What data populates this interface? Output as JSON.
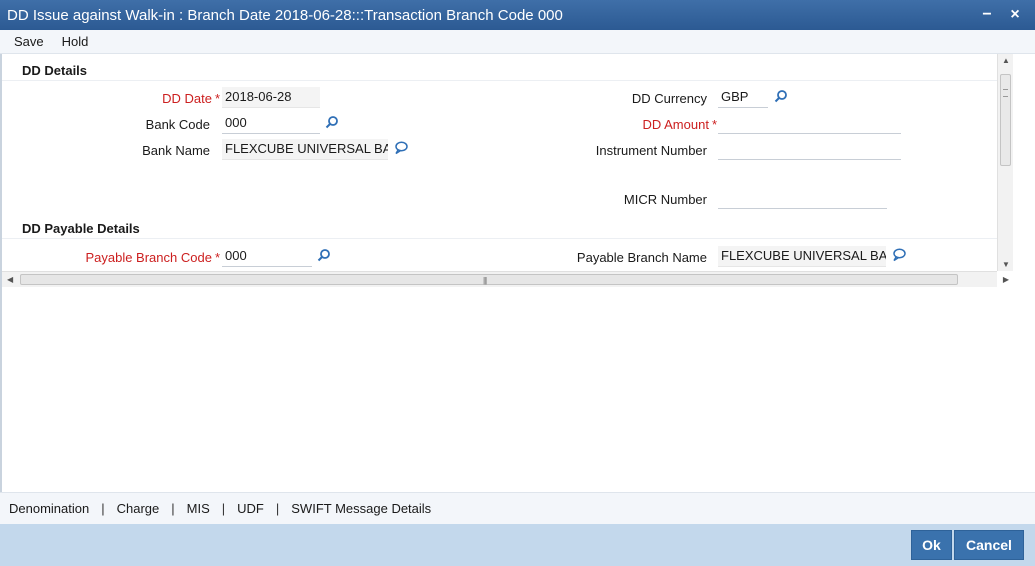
{
  "window": {
    "title": "DD Issue against Walk-in : Branch Date 2018-06-28:::Transaction Branch Code 000",
    "minimize_glyph": "−",
    "close_glyph": "×"
  },
  "menu": {
    "save": "Save",
    "hold": "Hold"
  },
  "dd_details": {
    "header": "DD Details",
    "dd_date_label": "DD Date",
    "dd_date_value": "2018-06-28",
    "bank_code_label": "Bank Code",
    "bank_code_value": "000",
    "bank_name_label": "Bank Name",
    "bank_name_value": "FLEXCUBE UNIVERSAL BA",
    "dd_currency_label": "DD Currency",
    "dd_currency_value": "GBP",
    "dd_amount_label": "DD Amount",
    "dd_amount_value": "",
    "instrument_number_label": "Instrument Number",
    "instrument_number_value": "",
    "micr_number_label": "MICR Number",
    "micr_number_value": "",
    "required_marker": "*"
  },
  "payable_details": {
    "header": "DD Payable Details",
    "payable_branch_code_label": "Payable Branch Code",
    "payable_branch_code_value": "000",
    "payable_branch_name_label": "Payable Branch Name",
    "payable_branch_name_value": "FLEXCUBE UNIVERSAL BA"
  },
  "subtabs": {
    "denomination": "Denomination",
    "charge": "Charge",
    "mis": "MIS",
    "udf": "UDF",
    "swift": "SWIFT Message Details",
    "separator": "|"
  },
  "footer": {
    "ok": "Ok",
    "cancel": "Cancel"
  },
  "icons": {
    "lookup": "search-icon",
    "detail": "speech-bubble-icon"
  },
  "colors": {
    "title_bar": "#2c5a93",
    "required_label": "#cc1f1f",
    "footer_bg": "#c3d8ec",
    "button_bg": "#3a72ad",
    "icon": "#2f6fb6"
  }
}
